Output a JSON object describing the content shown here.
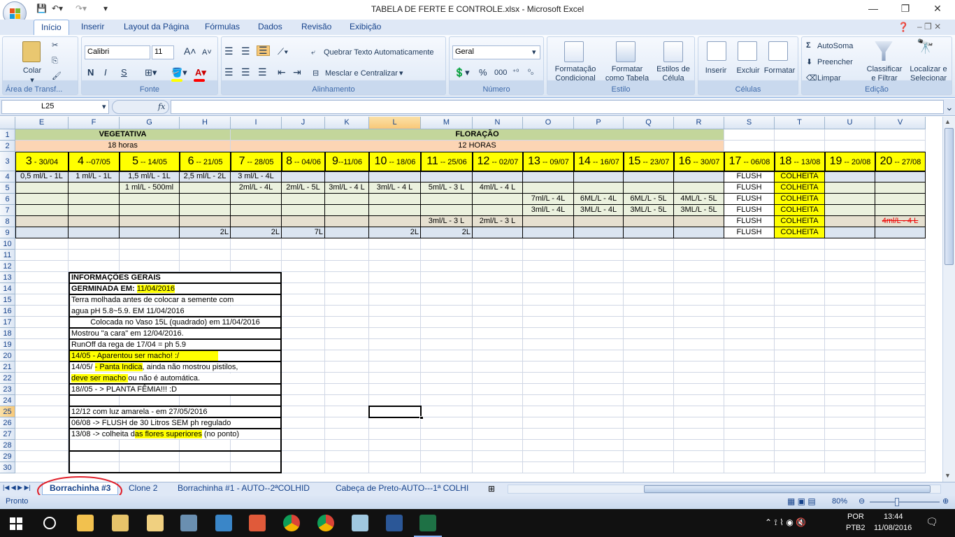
{
  "window": {
    "title": "TABELA DE FERTE E CONTROLE.xlsx - Microsoft Excel",
    "minimize": "—",
    "restore": "❐",
    "close": "✕"
  },
  "ribbon_tabs": [
    "Início",
    "Inserir",
    "Layout da Página",
    "Fórmulas",
    "Dados",
    "Revisão",
    "Exibição"
  ],
  "ribbon": {
    "clipboard": {
      "label": "Área de Transf...",
      "paste": "Colar"
    },
    "font": {
      "label": "Fonte",
      "name": "Calibri",
      "size": "11",
      "bold": "N",
      "italic": "I",
      "underline": "S"
    },
    "alignment": {
      "label": "Alinhamento",
      "wrap": "Quebrar Texto Automaticamente",
      "merge": "Mesclar e Centralizar"
    },
    "number": {
      "label": "Número",
      "format": "Geral",
      "percent": "%",
      "thousands": "000"
    },
    "styles": {
      "label": "Estilo",
      "cond1": "Formatação",
      "cond2": "Condicional",
      "table1": "Formatar",
      "table2": "como Tabela",
      "cell1": "Estilos de",
      "cell2": "Célula"
    },
    "cells": {
      "label": "Células",
      "insert": "Inserir",
      "delete": "Excluir",
      "format": "Formatar"
    },
    "editing": {
      "label": "Edição",
      "autosum": "AutoSoma",
      "fill": "Preencher",
      "clear": "Limpar",
      "sort1": "Classificar",
      "sort2": "e Filtrar",
      "find1": "Localizar e",
      "find2": "Selecionar"
    }
  },
  "formula_bar": {
    "name_box": "L25",
    "fx": "fx",
    "content": ""
  },
  "columns": [
    "E",
    "F",
    "G",
    "H",
    "I",
    "J",
    "K",
    "L",
    "M",
    "N",
    "O",
    "P",
    "Q",
    "R",
    "S",
    "T",
    "U",
    "V"
  ],
  "rows": [
    "1",
    "2",
    "3",
    "4",
    "5",
    "6",
    "7",
    "8",
    "9",
    "10",
    "11",
    "12",
    "13",
    "14",
    "15",
    "16",
    "17",
    "18",
    "19",
    "20",
    "21",
    "22",
    "23",
    "24",
    "25",
    "26",
    "27",
    "28",
    "29",
    "30"
  ],
  "sheet": {
    "r1_veg": "VEGETATIVA",
    "r1_flor": "FLORAÇÃO",
    "r2_veg": "18 horas",
    "r2_flor": "12 HORAS",
    "weeks": [
      {
        "n": "3",
        "d": " - 30/04"
      },
      {
        "n": "4",
        "d": " --07/05"
      },
      {
        "n": "5",
        "d": " -- 14/05"
      },
      {
        "n": "6",
        "d": " -- 21/05"
      },
      {
        "n": "7",
        "d": " -- 28/05"
      },
      {
        "n": "8",
        "d": " -- 04/06"
      },
      {
        "n": "9",
        "d": "--11/06"
      },
      {
        "n": "10",
        "d": " -- 18/06"
      },
      {
        "n": "11",
        "d": " -- 25/06"
      },
      {
        "n": "12",
        "d": " -- 02/07"
      },
      {
        "n": "13",
        "d": " -- 09/07"
      },
      {
        "n": "14",
        "d": " -- 16/07"
      },
      {
        "n": "15",
        "d": " -- 23/07"
      },
      {
        "n": "16",
        "d": " -- 30/07"
      },
      {
        "n": "17",
        "d": " -- 06/08"
      },
      {
        "n": "18",
        "d": " -- 13/08"
      },
      {
        "n": "19",
        "d": " -- 20/08"
      },
      {
        "n": "20",
        "d": " -- 27/08"
      }
    ],
    "r4": [
      "0,5 ml/L - 1L",
      "1 ml/L - 1L",
      "1,5 ml/L - 1L",
      "2,5 ml/L - 2L",
      "3 ml/L - 4L",
      "",
      "",
      "",
      "",
      "",
      "",
      "",
      "",
      "",
      "FLUSH",
      "COLHEITA",
      "",
      ""
    ],
    "r5": [
      "",
      "",
      "1 ml/L - 500ml",
      "",
      "2ml/L - 4L",
      "2ml/L - 5L",
      "3ml/L - 4 L",
      "3ml/L - 4 L",
      "5ml/L - 3 L",
      "4ml/L - 4 L",
      "",
      "",
      "",
      "",
      "FLUSH",
      "COLHEITA",
      "",
      ""
    ],
    "r6": [
      "",
      "",
      "",
      "",
      "",
      "",
      "",
      "",
      "",
      "",
      "7ml/L - 4L",
      "6ML/L - 4L",
      "6ML/L - 5L",
      "4ML/L - 5L",
      "FLUSH",
      "COLHEITA",
      "",
      ""
    ],
    "r7": [
      "",
      "",
      "",
      "",
      "",
      "",
      "",
      "",
      "",
      "",
      "3ml/L - 4L",
      "3ML/L - 4L",
      "3ML/L - 5L",
      "3ML/L - 5L",
      "FLUSH",
      "COLHEITA",
      "",
      ""
    ],
    "r8": [
      "",
      "",
      "",
      "",
      "",
      "",
      "",
      "",
      "3ml/L - 3 L",
      "2ml/L - 3 L",
      "",
      "",
      "",
      "",
      "FLUSH",
      "COLHEITA",
      "",
      "4ml/L - 4 L"
    ],
    "r9": [
      "",
      "",
      "",
      "2L",
      "2L",
      "7L",
      "",
      "2L",
      "2L",
      "",
      "",
      "",
      "",
      "",
      "FLUSH",
      "COLHEITA",
      "",
      ""
    ],
    "info": [
      {
        "row": 13,
        "text": "INFORMAÇÕES GERAIS"
      },
      {
        "row": 14,
        "text": "GERMINADA EM: ",
        "hl": " 11/04/2016   "
      },
      {
        "row": 15,
        "text": "Terra molhada antes de colocar a semente com"
      },
      {
        "row": 16,
        "text": "agua pH 5.8~5.9. EM 11/04/2016"
      },
      {
        "row": 17,
        "text": "Colocada no Vaso 15L (quadrado) em 11/04/2016"
      },
      {
        "row": 18,
        "text": "Mostrou \"a cara\" em 12/04/2016."
      },
      {
        "row": 19,
        "text": "RunOff da rega de 17/04 = ph 5.9"
      },
      {
        "row": 20,
        "text": "14/05 - Aparentou ser macho! :/"
      },
      {
        "row": 21,
        "pre": "14/05/ ",
        "hl": "- Panta Indica",
        "post": ", ainda não mostrou pistilos,"
      },
      {
        "row": 22,
        "hl": "deve ser macho ",
        "post": "ou não é automática."
      },
      {
        "row": 23,
        "text": "18//05 - > PLANTA FÊMIA!!! :D"
      },
      {
        "row": 25,
        "text": "12/12 com luz amarela - em 27/05/2016"
      },
      {
        "row": 26,
        "text": "06/08 -> FLUSH de 30 Litros SEM ph regulado"
      },
      {
        "row": 27,
        "pre": "13/08 -> colheita d",
        "hl": "as flores superiores",
        "post": " (no ponto)"
      }
    ]
  },
  "sheet_tabs": [
    "Borrachinha #3",
    "Clone 2",
    "Borrachinha #1 - AUTO--2ªCOLHID",
    "Cabeça de Preto-AUTO---1ª COLHI"
  ],
  "status": {
    "ready": "Pronto",
    "zoom": "80%"
  },
  "taskbar": {
    "lang1": "POR",
    "lang2": "PTB2",
    "time": "13:44",
    "date": "11/08/2016"
  }
}
